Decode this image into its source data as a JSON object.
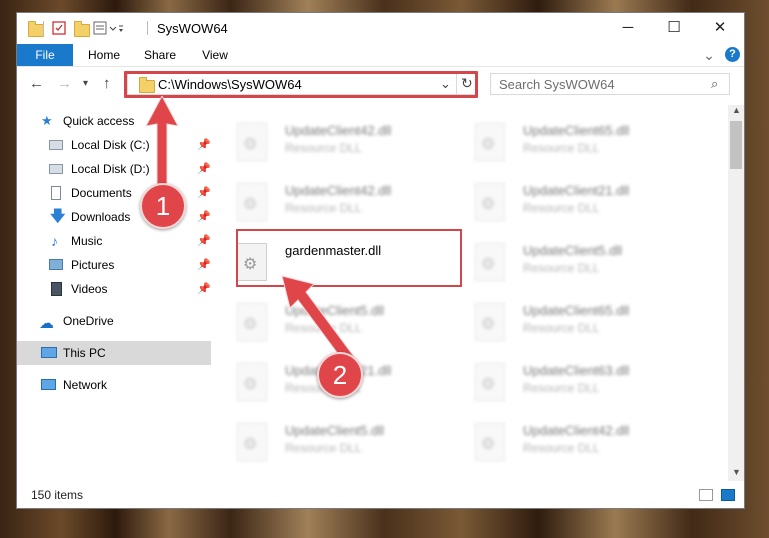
{
  "window": {
    "title": "SysWOW64",
    "minimize": "─",
    "maximize": "☐",
    "close": "✕"
  },
  "ribbon": {
    "tabs": [
      {
        "label": "File"
      },
      {
        "label": "Home"
      },
      {
        "label": "Share"
      },
      {
        "label": "View"
      }
    ],
    "collapse_glyph": "⌄",
    "help_glyph": "?"
  },
  "address": {
    "path": "C:\\Windows\\SysWOW64",
    "search_placeholder": "Search SysWOW64"
  },
  "nav": {
    "items": [
      {
        "label": "Quick access",
        "icon": "star-icon"
      },
      {
        "label": "Local Disk (C:)",
        "icon": "drive-icon",
        "pinned": true
      },
      {
        "label": "Local Disk (D:)",
        "icon": "drive-icon",
        "pinned": true
      },
      {
        "label": "Documents",
        "icon": "document-icon",
        "pinned": true
      },
      {
        "label": "Downloads",
        "icon": "download-icon",
        "pinned": true
      },
      {
        "label": "Music",
        "icon": "music-icon",
        "pinned": true
      },
      {
        "label": "Pictures",
        "icon": "pictures-icon",
        "pinned": true
      },
      {
        "label": "Videos",
        "icon": "video-icon",
        "pinned": true
      },
      {
        "label": "OneDrive",
        "icon": "cloud-icon"
      },
      {
        "label": "This PC",
        "icon": "computer-icon",
        "selected": true
      },
      {
        "label": "Network",
        "icon": "network-icon"
      }
    ]
  },
  "files": [
    {
      "name": "UpdateClient42.dll",
      "type": "Resource DLL"
    },
    {
      "name": "UpdateClient65.dll",
      "type": "Resource DLL"
    },
    {
      "name": "UpdateClient42.dll",
      "type": "Resource DLL"
    },
    {
      "name": "UpdateClient21.dll",
      "type": "Resource DLL"
    },
    {
      "name": "gardenmaster.dll",
      "type": ""
    },
    {
      "name": "UpdateClient5.dll",
      "type": "Resource DLL"
    },
    {
      "name": "UpdateClient5.dll",
      "type": "Resource DLL"
    },
    {
      "name": "UpdateClient65.dll",
      "type": "Resource DLL"
    },
    {
      "name": "UpdateClient21.dll",
      "type": "Resource DLL"
    },
    {
      "name": "UpdateClient63.dll",
      "type": "Resource DLL"
    },
    {
      "name": "UpdateClient5.dll",
      "type": "Resource DLL"
    },
    {
      "name": "UpdateClient42.dll",
      "type": "Resource DLL"
    }
  ],
  "status": {
    "item_count": "150 items"
  },
  "callouts": {
    "step1": "1",
    "step2": "2",
    "color": "#e0454a"
  }
}
